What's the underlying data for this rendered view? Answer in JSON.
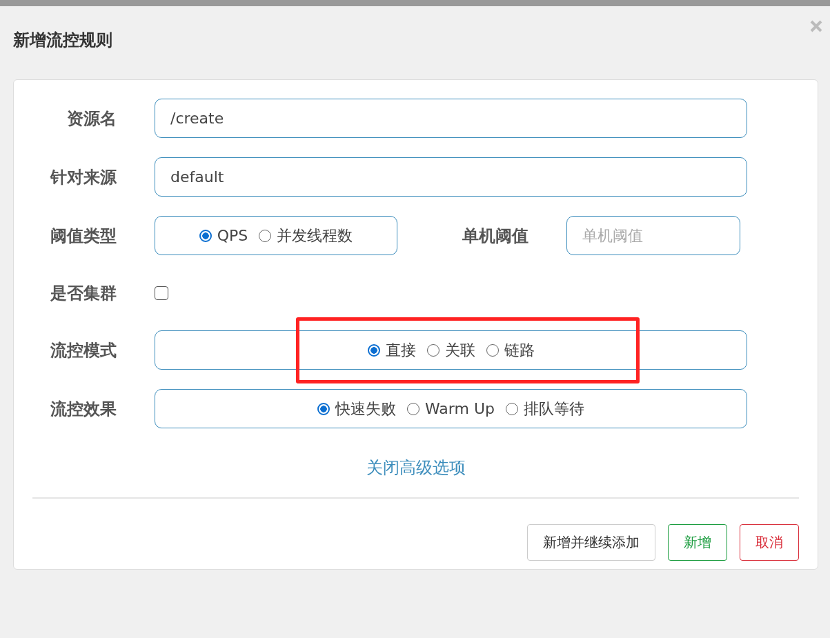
{
  "dialog": {
    "title": "新增流控规则"
  },
  "form": {
    "resource": {
      "label": "资源名",
      "value": "/create"
    },
    "origin": {
      "label": "针对来源",
      "value": "default"
    },
    "threshold_type": {
      "label": "阈值类型",
      "options": [
        {
          "label": "QPS",
          "selected": true
        },
        {
          "label": "并发线程数",
          "selected": false
        }
      ]
    },
    "threshold": {
      "label": "单机阈值",
      "placeholder": "单机阈值"
    },
    "cluster": {
      "label": "是否集群",
      "checked": false
    },
    "mode": {
      "label": "流控模式",
      "highlighted": true,
      "options": [
        {
          "label": "直接",
          "selected": true
        },
        {
          "label": "关联",
          "selected": false
        },
        {
          "label": "链路",
          "selected": false
        }
      ]
    },
    "effect": {
      "label": "流控效果",
      "options": [
        {
          "label": "快速失败",
          "selected": true
        },
        {
          "label": "Warm Up",
          "selected": false
        },
        {
          "label": "排队等待",
          "selected": false
        }
      ]
    }
  },
  "advanced_toggle": "关闭高级选项",
  "buttons": [
    {
      "label": "新增并继续添加",
      "kind": "default"
    },
    {
      "label": "新增",
      "kind": "success"
    },
    {
      "label": "取消",
      "kind": "danger"
    }
  ]
}
